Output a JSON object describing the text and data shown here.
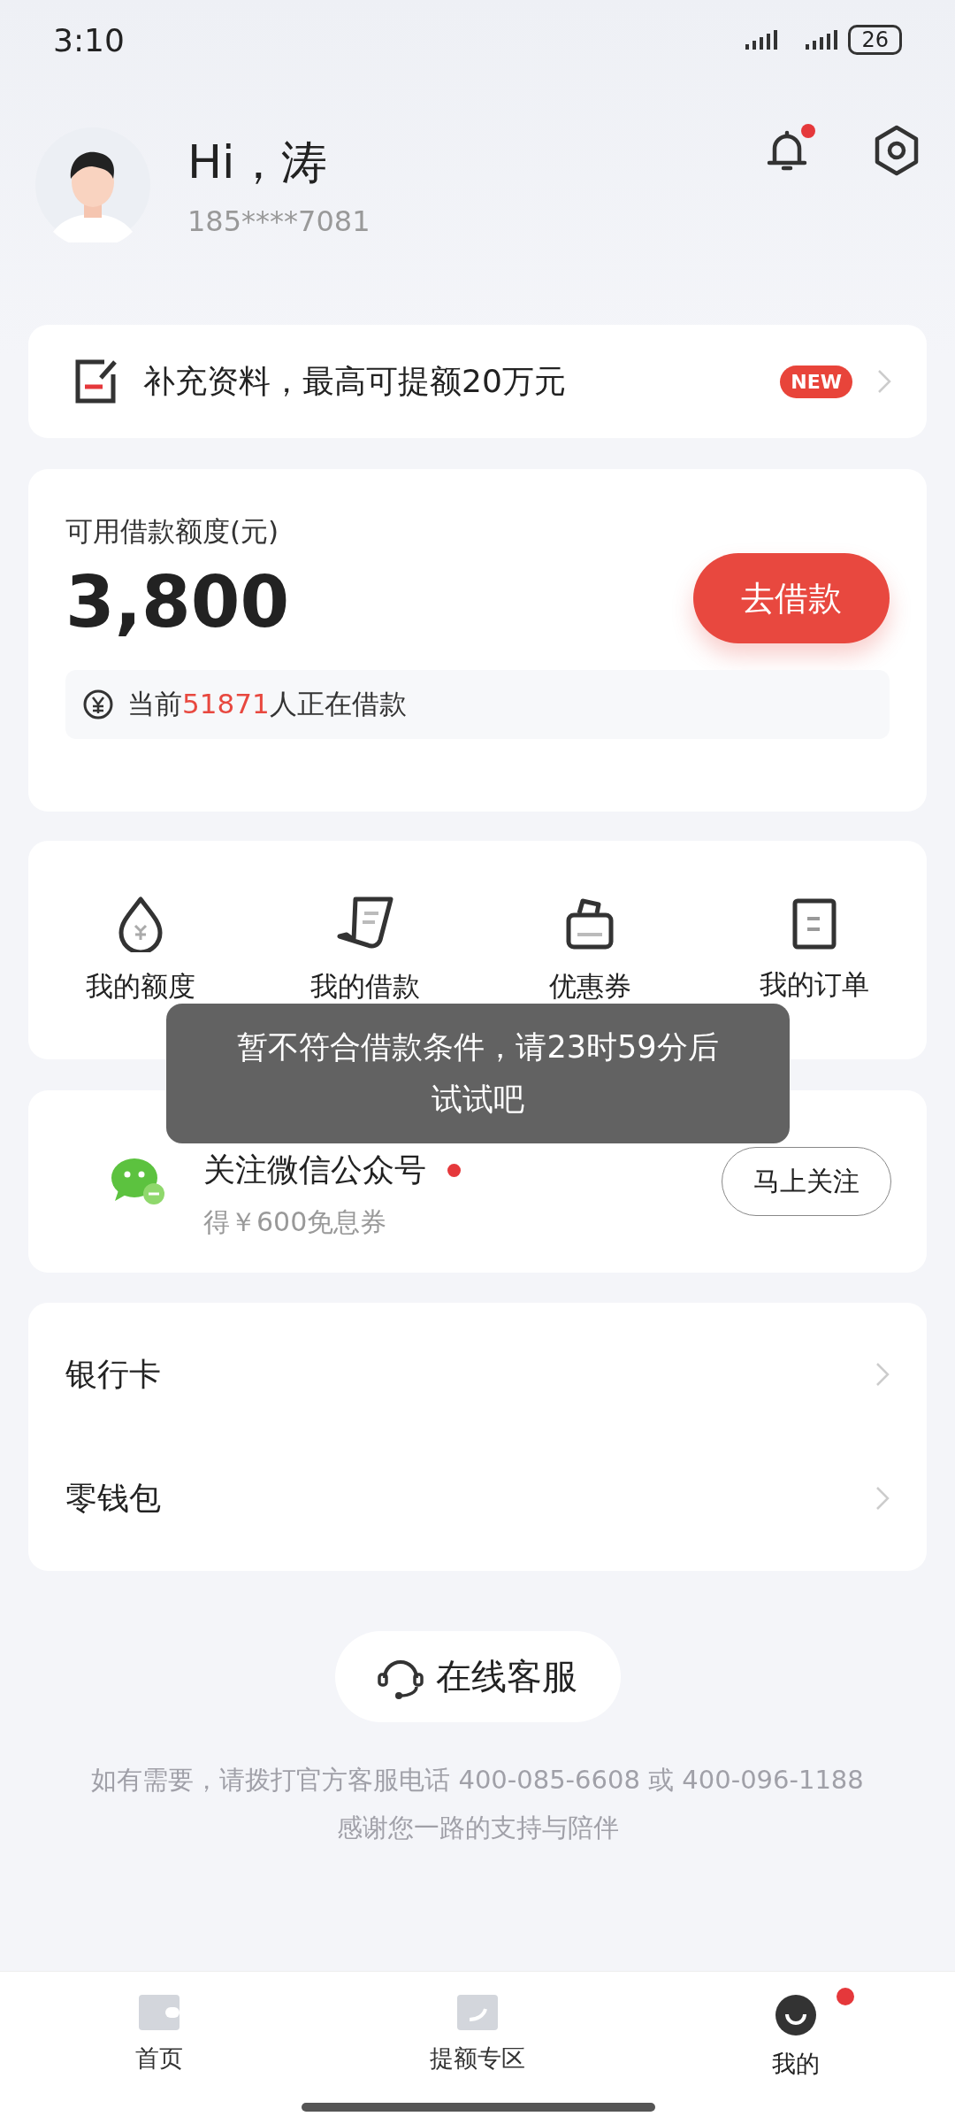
{
  "status_bar": {
    "time": "3:10",
    "battery": "26"
  },
  "header": {
    "greeting": "Hi，涛",
    "phone": "185****7081",
    "bell_dot": true
  },
  "promo_banner": {
    "text": "补充资料，最高可提额20万元",
    "badge": "NEW"
  },
  "quota_card": {
    "label": "可用借款额度(元)",
    "amount": "3,800",
    "button": "去借款",
    "notice": {
      "before": "当前",
      "count": "51871",
      "after": "人正在借款"
    }
  },
  "shortcuts": [
    {
      "kind": "quota",
      "label": "我的额度"
    },
    {
      "kind": "loan",
      "label": "我的借款"
    },
    {
      "kind": "coupon",
      "label": "优惠券"
    },
    {
      "kind": "order",
      "label": "我的订单"
    }
  ],
  "wechat_card": {
    "title": "关注微信公众号",
    "dot": true,
    "subtitle": "得￥600免息券",
    "button": "马上关注"
  },
  "menu": [
    {
      "label": "银行卡"
    },
    {
      "label": "零钱包"
    }
  ],
  "service_button": "在线客服",
  "footer": [
    "如有需要，请拨打官方客服电话 400-085-6608 或 400-096-1188",
    "感谢您一路的支持与陪伴"
  ],
  "toast": [
    "暂不符合借款条件，请23时59分后",
    "试试吧"
  ],
  "tab_bar": [
    {
      "kind": "home",
      "label": "首页",
      "selected": false,
      "dot": false
    },
    {
      "kind": "boost",
      "label": "提额专区",
      "selected": false,
      "dot": false
    },
    {
      "kind": "me",
      "label": "我的",
      "selected": true,
      "dot": true
    }
  ]
}
